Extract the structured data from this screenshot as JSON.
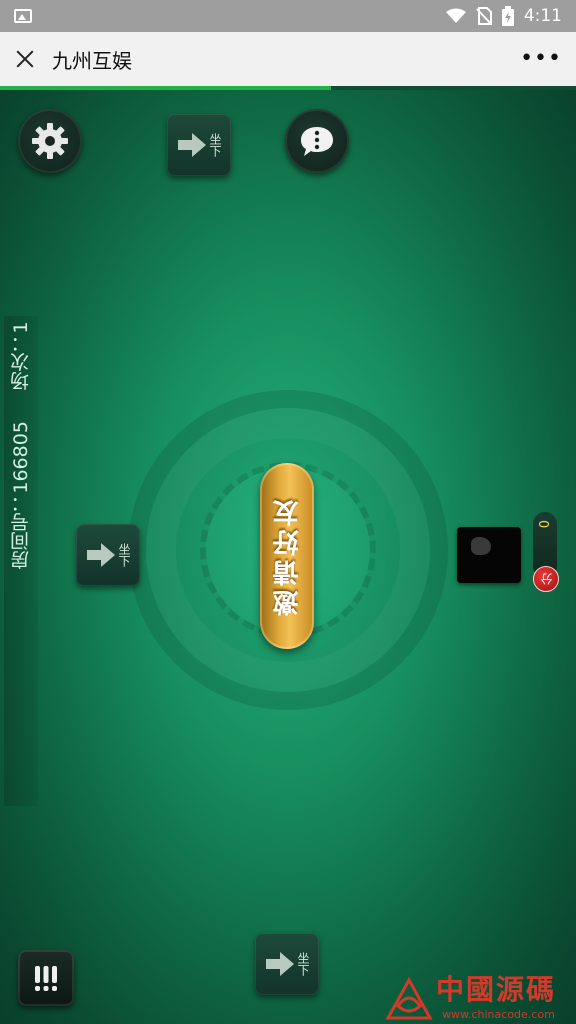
{
  "status_bar": {
    "time": "4:11"
  },
  "title_bar": {
    "title": "九州互娱"
  },
  "page_progress": 0.575,
  "seats": {
    "label": "坐下"
  },
  "room": {
    "number_label": "房间号：166805",
    "round_label": "场次：1"
  },
  "invite_button": {
    "label": "邀请好友"
  },
  "player": {
    "score": "0",
    "score_unit": "分"
  },
  "watermark": {
    "text": "中國源碼",
    "url": "www.chinacode.com"
  },
  "colors": {
    "felt": "#178e5f",
    "gold": "#e0a83a",
    "badge_red": "#c41d1d",
    "progress": "#21b24a"
  },
  "icons": [
    "image-icon",
    "wifi-icon",
    "no-sim-icon",
    "battery-icon",
    "close-icon",
    "more-icon",
    "gear-icon",
    "chat-icon",
    "arrow-right-icon",
    "menu-icon"
  ]
}
